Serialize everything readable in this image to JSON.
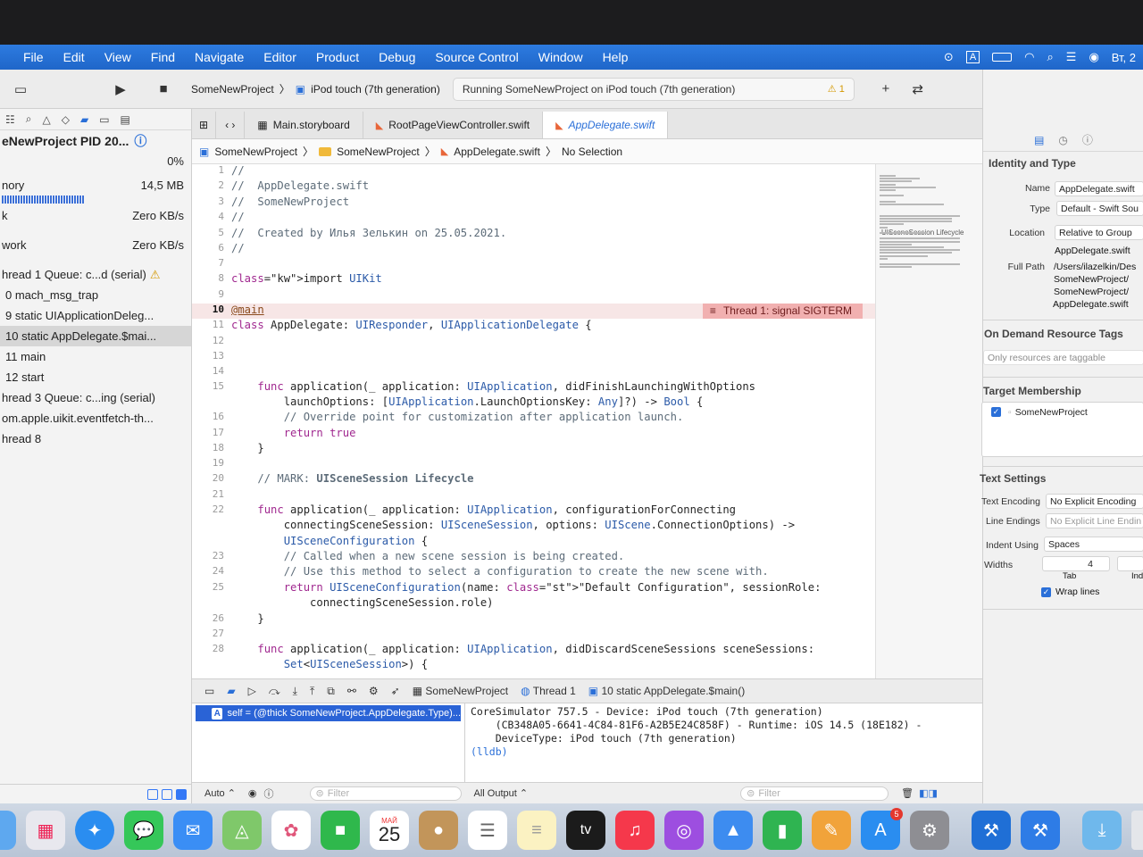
{
  "menubar": {
    "items": [
      "File",
      "Edit",
      "View",
      "Find",
      "Navigate",
      "Editor",
      "Product",
      "Debug",
      "Source Control",
      "Window",
      "Help"
    ],
    "clock": "Вт, 2"
  },
  "toolbar": {
    "scheme_project": "SomeNewProject",
    "scheme_device": "iPod touch (7th generation)",
    "activity_status": "Running SomeNewProject on iPod touch (7th generation)",
    "warning_count": "1"
  },
  "navigator": {
    "process": "eNewProject PID 20...",
    "cpu_value": "0%",
    "memory_label": "nory",
    "memory_value": "14,5 MB",
    "disk_label": "k",
    "disk_value": "Zero KB/s",
    "network_label": "work",
    "network_value": "Zero KB/s",
    "threads": [
      {
        "label": "hread 1 Queue: c...d (serial)",
        "indent": 0
      },
      {
        "label": "0 mach_msg_trap",
        "indent": 1
      },
      {
        "label": "9 static UIApplicationDeleg...",
        "indent": 1
      },
      {
        "label": "10 static AppDelegate.$mai...",
        "indent": 1
      },
      {
        "label": "11 main",
        "indent": 1
      },
      {
        "label": "12 start",
        "indent": 1
      },
      {
        "label": "hread 3 Queue: c...ing (serial)",
        "indent": 0
      },
      {
        "label": "om.apple.uikit.eventfetch-th...",
        "indent": 0
      },
      {
        "label": "hread 8",
        "indent": 0
      }
    ]
  },
  "tabs": [
    {
      "label": "Main.storyboard"
    },
    {
      "label": "RootPageViewController.swift"
    },
    {
      "label": "AppDelegate.swift"
    }
  ],
  "breadcrumb": {
    "project": "SomeNewProject",
    "group": "SomeNewProject",
    "file": "AppDelegate.swift",
    "selection": "No Selection"
  },
  "editor": {
    "error_message": "Thread 1: signal SIGTERM",
    "lines": [
      {
        "n": "1",
        "text": "//"
      },
      {
        "n": "2",
        "text": "//  AppDelegate.swift"
      },
      {
        "n": "3",
        "text": "//  SomeNewProject"
      },
      {
        "n": "4",
        "text": "//"
      },
      {
        "n": "5",
        "text": "//  Created by Илья Зелькин on 25.05.2021."
      },
      {
        "n": "6",
        "text": "//"
      },
      {
        "n": "7",
        "text": ""
      },
      {
        "n": "8",
        "text": "import UIKit"
      },
      {
        "n": "9",
        "text": ""
      },
      {
        "n": "10",
        "text": "@main"
      },
      {
        "n": "11",
        "text": "class AppDelegate: UIResponder, UIApplicationDelegate {"
      },
      {
        "n": "12",
        "text": ""
      },
      {
        "n": "13",
        "text": ""
      },
      {
        "n": "14",
        "text": ""
      },
      {
        "n": "15",
        "text": "    func application(_ application: UIApplication, didFinishLaunchingWithOptions"
      },
      {
        "n": "",
        "text": "        launchOptions: [UIApplication.LaunchOptionsKey: Any]?) -> Bool {"
      },
      {
        "n": "16",
        "text": "        // Override point for customization after application launch."
      },
      {
        "n": "17",
        "text": "        return true"
      },
      {
        "n": "18",
        "text": "    }"
      },
      {
        "n": "19",
        "text": ""
      },
      {
        "n": "20",
        "text": "    // MARK: UISceneSession Lifecycle"
      },
      {
        "n": "21",
        "text": ""
      },
      {
        "n": "22",
        "text": "    func application(_ application: UIApplication, configurationForConnecting"
      },
      {
        "n": "",
        "text": "        connectingSceneSession: UISceneSession, options: UIScene.ConnectionOptions) ->"
      },
      {
        "n": "",
        "text": "        UISceneConfiguration {"
      },
      {
        "n": "23",
        "text": "        // Called when a new scene session is being created."
      },
      {
        "n": "24",
        "text": "        // Use this method to select a configuration to create the new scene with."
      },
      {
        "n": "25",
        "text": "        return UISceneConfiguration(name: \"Default Configuration\", sessionRole:"
      },
      {
        "n": "",
        "text": "            connectingSceneSession.role)"
      },
      {
        "n": "26",
        "text": "    }"
      },
      {
        "n": "27",
        "text": ""
      },
      {
        "n": "28",
        "text": "    func application(_ application: UIApplication, didDiscardSceneSessions sceneSessions:"
      },
      {
        "n": "",
        "text": "        Set<UISceneSession>) {"
      }
    ],
    "minimap_label": "UISceneSession Lifecycle"
  },
  "debugbar": {
    "project": "SomeNewProject",
    "thread": "Thread 1",
    "frame": "10 static AppDelegate.$main()"
  },
  "variables": {
    "row": "self = (@thick SomeNewProject.AppDelegate.Type)..."
  },
  "console": {
    "line1": "CoreSimulator 757.5 - Device: iPod touch (7th generation)",
    "line2": "    (CB348A05-6641-4C84-81F6-A2B5E24C858F) - Runtime: iOS 14.5 (18E182) -",
    "line3": "    DeviceType: iPod touch (7th generation)",
    "prompt": "(lldb)"
  },
  "bottombar": {
    "auto": "Auto",
    "filter_left": "Filter",
    "output": "All Output",
    "filter_right": "Filter"
  },
  "inspector": {
    "identity_title": "Identity and Type",
    "name_label": "Name",
    "name_value": "AppDelegate.swift",
    "type_label": "Type",
    "type_value": "Default - Swift Sou",
    "location_label": "Location",
    "location_value": "Relative to Group",
    "location_file": "AppDelegate.swift",
    "fullpath_label": "Full Path",
    "fullpath_1": "/Users/ilazelkin/Des",
    "fullpath_2": "SomeNewProject/",
    "fullpath_3": "SomeNewProject/",
    "fullpath_4": "AppDelegate.swift",
    "odr_title": "On Demand Resource Tags",
    "odr_placeholder": "Only resources are taggable",
    "target_title": "Target Membership",
    "target_item": "SomeNewProject",
    "text_title": "Text Settings",
    "encoding_label": "Text Encoding",
    "encoding_value": "No Explicit Encoding",
    "endings_label": "Line Endings",
    "endings_value": "No Explicit Line Endin",
    "indent_label": "Indent Using",
    "indent_value": "Spaces",
    "widths_label": "Widths",
    "widths_value": "4",
    "tab_label": "Tab",
    "indent_short": "Ind",
    "wrap_label": "Wrap lines"
  },
  "dock": {
    "calendar_month": "МАЙ",
    "calendar_day": "25",
    "tv_label": "tv",
    "appstore_badge": "5"
  }
}
